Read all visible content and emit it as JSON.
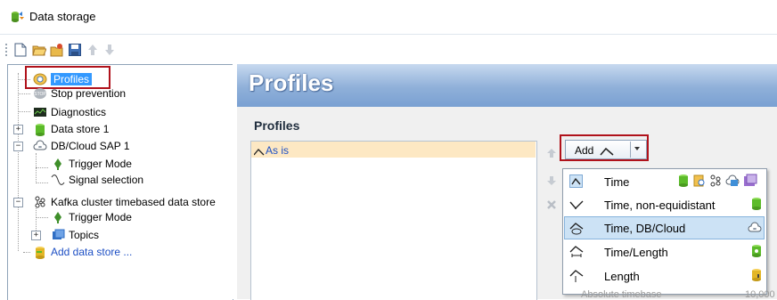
{
  "window": {
    "title": "Data storage"
  },
  "toolbar": {
    "buttons": [
      "new-icon",
      "open-icon",
      "open-settings-icon",
      "save-icon",
      "arrow-up-icon",
      "arrow-down-icon"
    ]
  },
  "tree": {
    "items": [
      {
        "label": "Profiles",
        "selected": true
      },
      {
        "label": "Stop prevention"
      },
      {
        "label": "Diagnostics"
      },
      {
        "label": "Data store 1"
      },
      {
        "label": "DB/Cloud SAP 1"
      },
      {
        "label": "Trigger Mode"
      },
      {
        "label": "Signal selection"
      },
      {
        "label": "Kafka cluster timebased data store"
      },
      {
        "label": "Trigger Mode"
      },
      {
        "label": "Topics"
      },
      {
        "label": "Add data store ..."
      }
    ]
  },
  "panel": {
    "header": "Profiles",
    "section_title": "Profiles",
    "list_items": [
      "As is"
    ]
  },
  "add_button": {
    "label": "Add"
  },
  "dropdown": {
    "items": [
      {
        "label": "Time"
      },
      {
        "label": "Time, non-equidistant"
      },
      {
        "label": "Time, DB/Cloud",
        "selected": true
      },
      {
        "label": "Time/Length"
      },
      {
        "label": "Length"
      }
    ]
  },
  "background": {
    "partial_label": "Absolute timebase",
    "partial_value": "10,000"
  },
  "colors": {
    "highlight_box": "#b0121b",
    "header_blue": "#7aa0d2",
    "selection": "#cce2f5",
    "list_selection": "#fde8c3"
  }
}
